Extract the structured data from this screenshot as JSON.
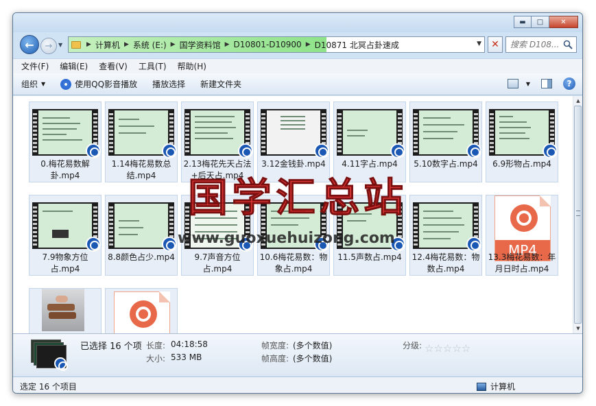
{
  "window": {
    "controls": {
      "minimize": "▬",
      "maximize": "□",
      "close": "✕"
    }
  },
  "nav": {
    "breadcrumbs": [
      "计算机",
      "系统 (E:)",
      "国学资料馆",
      "D10801-D10900",
      "D10871 北冥占卦速成"
    ],
    "search_placeholder": "搜索 D108...",
    "close_symbol": "✕"
  },
  "menu": [
    "文件(F)",
    "编辑(E)",
    "查看(V)",
    "工具(T)",
    "帮助(H)"
  ],
  "toolbar": {
    "organize": "组织",
    "play_qq": "使用QQ影音播放",
    "play_selection": "播放选择",
    "new_folder": "新建文件夹",
    "help": "?"
  },
  "files": [
    {
      "name": "0.梅花易数解卦.mp4",
      "kind": "video"
    },
    {
      "name": "1.14梅花易数总结.mp4",
      "kind": "video"
    },
    {
      "name": "2.13梅花先天占法+后天占.mp4",
      "kind": "video"
    },
    {
      "name": "3.12金钱卦.mp4",
      "kind": "video"
    },
    {
      "name": "4.11字占.mp4",
      "kind": "video"
    },
    {
      "name": "5.10数字占.mp4",
      "kind": "video"
    },
    {
      "name": "6.9形物占.mp4",
      "kind": "video"
    },
    {
      "name": "7.9物象方位占.mp4",
      "kind": "video"
    },
    {
      "name": "8.8颜色占少.mp4",
      "kind": "video"
    },
    {
      "name": "9.7声音方位占.mp4",
      "kind": "video"
    },
    {
      "name": "10.6梅花易数：物象占.mp4",
      "kind": "video"
    },
    {
      "name": "11.5声数占.mp4",
      "kind": "video"
    },
    {
      "name": "12.4梅花易数：物数占.mp4",
      "kind": "video"
    },
    {
      "name": "13.3梅花易数：年月日时占.mp4",
      "kind": "mp4"
    }
  ],
  "mp4_badge": "MP4",
  "details": {
    "selected": "已选择 16 个项",
    "length_key": "长度:",
    "length_val": "04:18:58",
    "size_key": "大小:",
    "size_val": "533 MB",
    "fw_key": "帧宽度:",
    "fw_val": "(多个数值)",
    "fh_key": "帧高度:",
    "fh_val": "(多个数值)",
    "rating_key": "分级:",
    "rating_stars": "☆☆☆☆☆"
  },
  "status": {
    "left": "选定 16 个项目",
    "right": "计算机"
  },
  "watermark": {
    "title": "国学汇总站",
    "url": "www.guoxuehuizong.com"
  }
}
